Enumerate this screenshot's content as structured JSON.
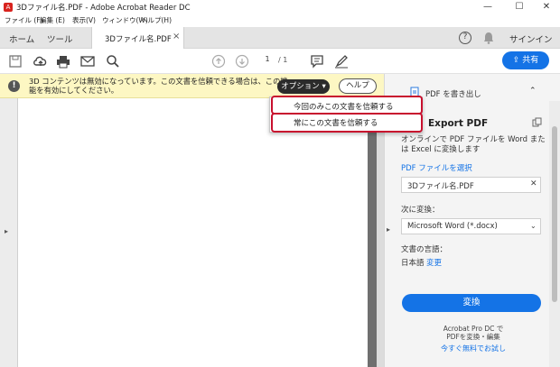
{
  "window": {
    "app_icon_glyph": "A",
    "title": "3Dファイル名.PDF - Adobe Acrobat Reader DC",
    "minimize": "—",
    "maximize": "☐",
    "close": "✕"
  },
  "menu": [
    "ファイル (F)",
    "編集 (E)",
    "表示(V)",
    "ウィンドウ(W)",
    "ヘルプ(H)"
  ],
  "tabs": {
    "home": "ホーム",
    "tools": "ツール",
    "document": "3Dファイル名.PDF",
    "close": "×",
    "help_icon": "?",
    "signin": "サインイン"
  },
  "toolbar": {
    "page_current": "1",
    "page_total": "/ 1",
    "share_label": "共有"
  },
  "notice": {
    "message": "3D コンテンツは無効になっています。この文書を信頼できる場合は、この機能を有効にしてください。",
    "options_label": "オプション ▾",
    "help_label": "ヘルプ"
  },
  "dropdown": {
    "items": [
      "今回のみこの文書を信頼する",
      "常にこの文書を信頼する"
    ]
  },
  "right_panel": {
    "export_header": "PDF を書き出し",
    "export_title": "Export PDF",
    "description": "オンラインで PDF ファイルを Word または Excel に変換します",
    "select_file": "PDF ファイルを選択",
    "file_name": "3Dファイル名.PDF",
    "convert_to_label": "次に変換：",
    "convert_to_value": "Microsoft Word (*.docx)",
    "language_label": "文書の言語：",
    "language_value": "日本語",
    "language_change": "変更",
    "convert_button": "変換",
    "promo_line1": "Acrobat Pro DC で",
    "promo_line2": "PDFを変換・編集",
    "promo_link": "今すぐ無料でお試し"
  },
  "colors": {
    "accent_blue": "#1473e6",
    "notice_yellow": "#fdf7c3",
    "highlight_red": "#c8102e"
  }
}
